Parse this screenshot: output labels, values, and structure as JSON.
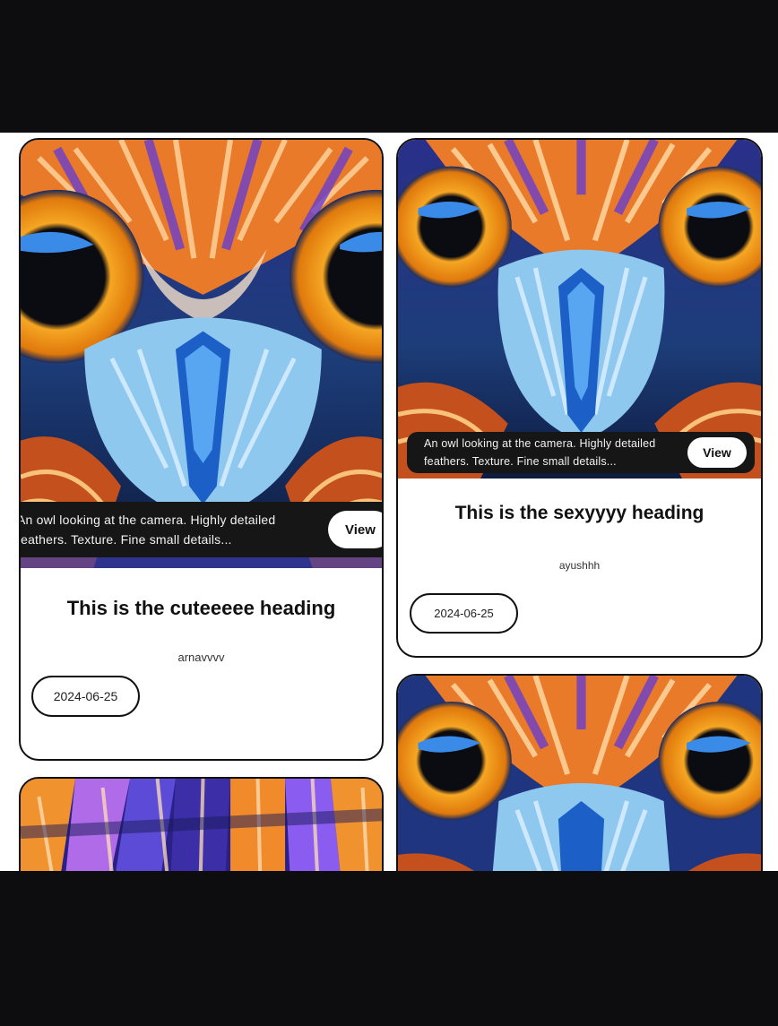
{
  "cards": [
    {
      "caption_line1": "An owl looking at the camera. Highly detailed",
      "caption_line2": "feathers. Texture. Fine small details...",
      "view_label": "View",
      "title": "This is the cuteeeee heading",
      "author": "arnavvvv",
      "date": "2024-06-25"
    },
    {
      "caption_line1": "An owl looking at the camera. Highly detailed",
      "caption_line2": "feathers. Texture. Fine small details...",
      "view_label": "View",
      "title": "This is the sexyyyy heading",
      "author": "ayushhh",
      "date": "2024-06-25"
    }
  ],
  "colors": {
    "page_background": "#ffffff",
    "frame": "#0d0d0f",
    "card_border": "#111111",
    "overlay": "#161616",
    "owl_eye": "#f29a1a",
    "owl_feather_blue": "#8ec8ef",
    "owl_feather_orange": "#e87a2a",
    "owl_feather_purple": "#6a3fd0"
  },
  "icons": [
    "owl-artwork-image"
  ]
}
